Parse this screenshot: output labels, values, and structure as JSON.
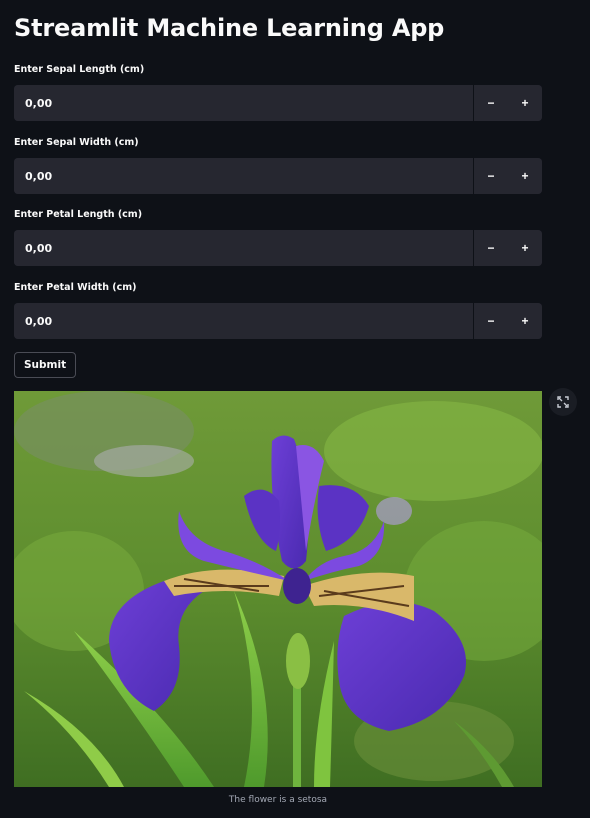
{
  "app": {
    "title": "Streamlit Machine Learning App"
  },
  "fields": [
    {
      "label": "Enter Sepal Length (cm)",
      "value": "0,00"
    },
    {
      "label": "Enter Sepal Width (cm)",
      "value": "0,00"
    },
    {
      "label": "Enter Petal Length (cm)",
      "value": "0,00"
    },
    {
      "label": "Enter Petal Width (cm)",
      "value": "0,00"
    }
  ],
  "stepper": {
    "decrement": "−",
    "increment": "+"
  },
  "submit_label": "Submit",
  "image": {
    "caption": "The flower is a setosa",
    "subject": "iris-flower-photo",
    "expand_icon": "fullscreen-icon"
  },
  "colors": {
    "background": "#0e1117",
    "input_bg": "#262730",
    "text": "#fafafa",
    "caption": "#a3a8b4"
  }
}
